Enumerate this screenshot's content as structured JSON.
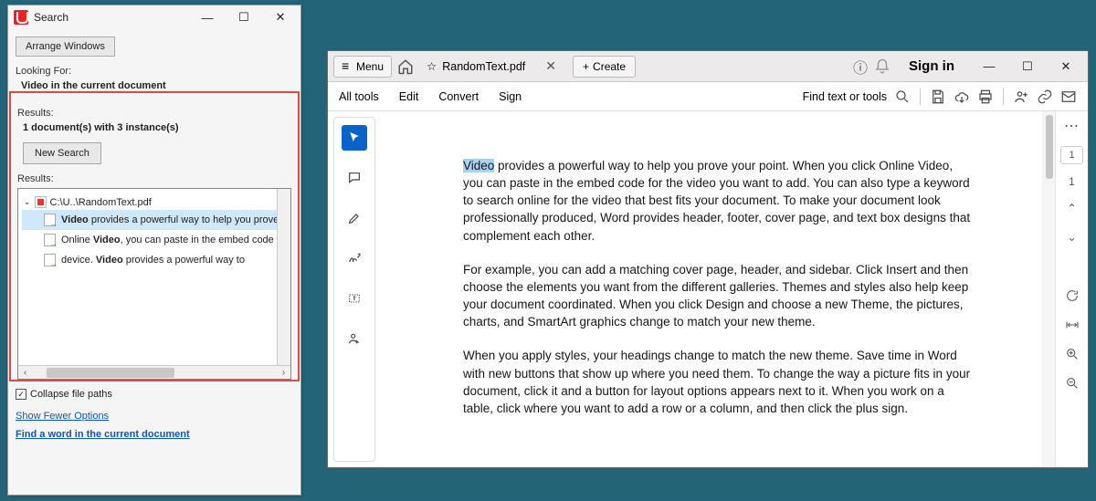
{
  "search": {
    "title": "Search",
    "arrange": "Arrange Windows",
    "lookingFor": "Looking For:",
    "query": "Video in the current document",
    "resultsHdr": "Results:",
    "summary": "1 document(s) with 3 instance(s)",
    "newSearch": "New Search",
    "resultsHdr2": "Results:",
    "file": "C:\\U..\\RandomText.pdf",
    "hits": [
      {
        "kw": "Video",
        "rest": " provides a powerful way to help you prove your"
      },
      {
        "pre": "Online ",
        "kw": "Video",
        "rest": ", you can paste in the embed code for the"
      },
      {
        "pre": "device. ",
        "kw": "Video",
        "rest": " provides a powerful way to"
      }
    ],
    "collapse": "Collapse file paths",
    "fewer": "Show Fewer Options",
    "findLink": "Find a word in the current document"
  },
  "reader": {
    "menu": "Menu",
    "tab": "RandomText.pdf",
    "create": "Create",
    "signin": "Sign in",
    "tools": {
      "all": "All tools",
      "edit": "Edit",
      "convert": "Convert",
      "sign": "Sign"
    },
    "find": "Find text or tools",
    "page": {
      "current": "1",
      "total": "1"
    },
    "para1_hl": "Video",
    "para1": " provides a powerful way to help you prove your point. When you click Online Video, you can paste in the embed code for the video you want to add. You can also type a keyword to search online for the video that best fits your document. To make your document look professionally produced, Word provides header, footer, cover page, and text box designs that complement each other.",
    "para2": "For example, you can add a matching cover page, header, and sidebar. Click Insert and then choose the elements you want from the different galleries. Themes and styles also help keep your document coordinated. When you click Design and choose a new Theme, the pictures, charts, and SmartArt graphics change to match your new theme.",
    "para3": "When you apply styles, your headings change to match the new theme. Save time in Word with new buttons that show up where you need them. To change the way a picture fits in your document, click it and a button for layout options appears next to it. When you work on a table, click where you want to add a row or a column, and then click the plus sign."
  }
}
